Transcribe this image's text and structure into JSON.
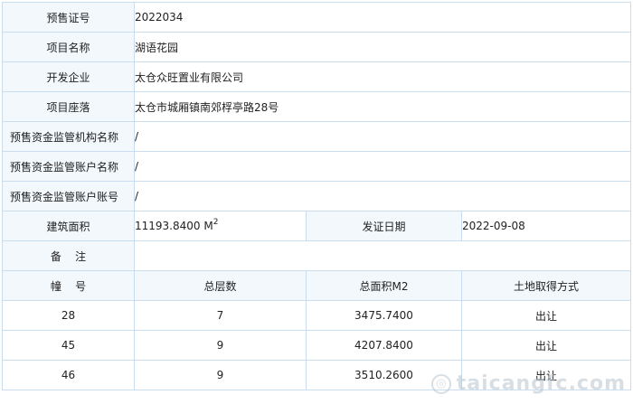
{
  "presale_cert": {
    "label": "预售证号",
    "value": "2022034"
  },
  "project_name": {
    "label": "项目名称",
    "value": "湖语花园"
  },
  "developer": {
    "label": "开发企业",
    "value": "太仓众旺置业有限公司"
  },
  "location": {
    "label": "项目座落",
    "value": "太仓市城厢镇南郊桴亭路28号"
  },
  "supervision_org": {
    "label": "预售资金监管机构名称",
    "value": "/"
  },
  "supervision_account_name": {
    "label": "预售资金监管账户名称",
    "value": "/"
  },
  "supervision_account_no": {
    "label": "预售资金监管账户账号",
    "value": "/"
  },
  "building_area": {
    "label": "建筑面积",
    "value": "11193.8400 M",
    "unit_sup": "2"
  },
  "issue_date": {
    "label": "发证日期",
    "value": "2022-09-08"
  },
  "remarks": {
    "label": "备    注",
    "value": ""
  },
  "buildings": {
    "headers": [
      "幢    号",
      "总层数",
      "总面积M2",
      "土地取得方式"
    ],
    "rows": [
      [
        "28",
        "7",
        "3475.7400",
        "出让"
      ],
      [
        "45",
        "9",
        "4207.8400",
        "出让"
      ],
      [
        "46",
        "9",
        "3510.2600",
        "出让"
      ]
    ]
  },
  "watermark": {
    "icon": "circle-logo-icon",
    "text": "taicangfc.com"
  }
}
